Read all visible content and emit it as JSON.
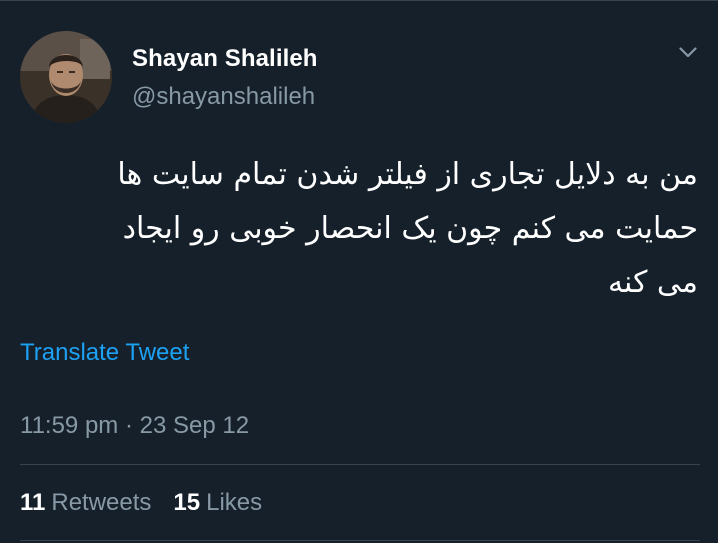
{
  "tweet": {
    "display_name": "Shayan Shalileh",
    "handle": "@shayanshalileh",
    "text_lines": [
      "من به دلایل تجاری از فیلتر شدن تمام سایت ها",
      "حمایت می کنم چون یک انحصار خوبی رو ایجاد",
      "می کنه"
    ],
    "translate_label": "Translate Tweet",
    "timestamp": "11:59 pm · 23 Sep 12",
    "retweets_count": "11",
    "retweets_label": "Retweets",
    "likes_count": "15",
    "likes_label": "Likes"
  },
  "icons": {
    "menu": "chevron-down-icon"
  },
  "colors": {
    "background": "#15202b",
    "primary_text": "#ffffff",
    "secondary_text": "#8899a6",
    "link": "#1da1f2",
    "divider": "#38444d"
  }
}
